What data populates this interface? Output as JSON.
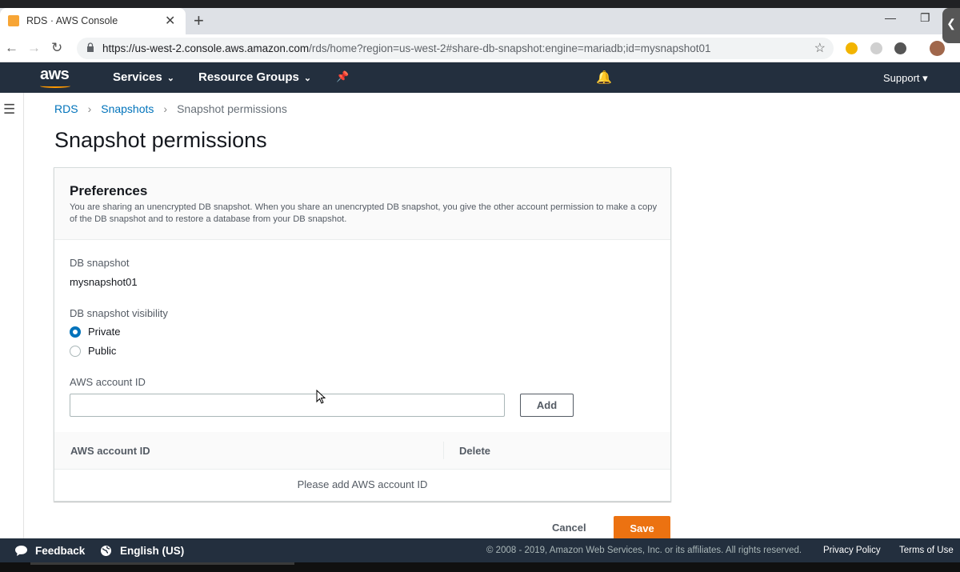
{
  "browser": {
    "tab_title": "RDS · AWS Console",
    "tab_close": "✕",
    "new_tab": "+",
    "url_host": "https://us-west-2.console.aws.amazon.com",
    "url_path": "/rds/home?region=us-west-2#share-db-snapshot:engine=mariadb;id=mysnapshot01",
    "back": "←",
    "forward": "→",
    "reload": "↻",
    "star": "☆",
    "minimize": "—",
    "restore": "❐",
    "side_arrow": "❮"
  },
  "aws_nav": {
    "logo": "aws",
    "services": "Services",
    "resource_groups": "Resource Groups",
    "chevron": "⌄",
    "pin": "📌",
    "bell": "🔔",
    "support": "Support ▾"
  },
  "page": {
    "hamburger": "☰",
    "breadcrumb": [
      "RDS",
      "Snapshots",
      "Snapshot permissions"
    ],
    "breadcrumb_sep": "›",
    "title": "Snapshot permissions"
  },
  "preferences": {
    "title": "Preferences",
    "description": "You are sharing an unencrypted DB snapshot. When you share an unencrypted DB snapshot, you give the other account permission to make a copy of the DB snapshot and to restore a database from your DB snapshot.",
    "db_snapshot_label": "DB snapshot",
    "db_snapshot_value": "mysnapshot01",
    "visibility_label": "DB snapshot visibility",
    "visibility_options": [
      "Private",
      "Public"
    ],
    "visibility_selected": "Private",
    "account_id_label": "AWS account ID",
    "account_id_value": "",
    "add_label": "Add"
  },
  "table": {
    "columns": [
      "AWS account ID",
      "Delete"
    ],
    "empty_text": "Please add AWS account ID"
  },
  "actions": {
    "cancel": "Cancel",
    "save": "Save"
  },
  "footer": {
    "feedback": "Feedback",
    "language": "English (US)",
    "copyright": "© 2008 - 2019, Amazon Web Services, Inc. or its affiliates. All rights reserved.",
    "privacy": "Privacy Policy",
    "terms": "Terms of Use"
  },
  "colors": {
    "aws_nav_bg": "#232f3e",
    "link": "#0073bb",
    "primary_button": "#ec7211",
    "aws_orange": "#ff9900"
  }
}
